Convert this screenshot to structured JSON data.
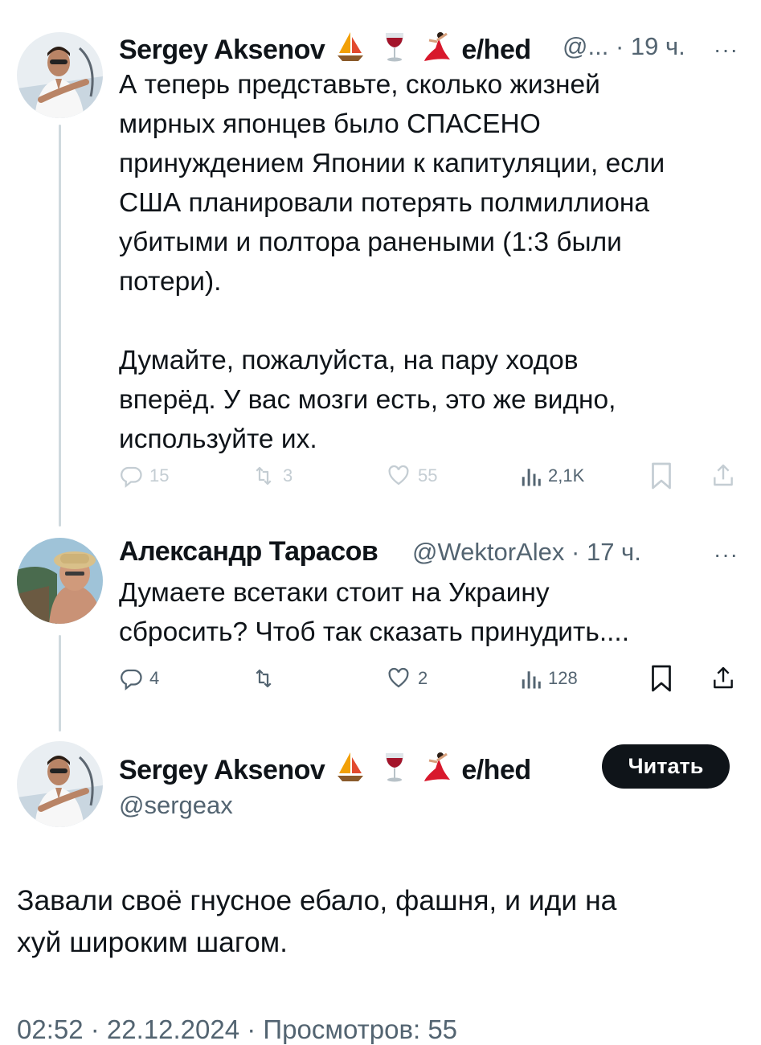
{
  "thread": [
    {
      "author": {
        "name": "Sergey Aksenov",
        "name_suffix": "e/hed",
        "handle": "@...",
        "time": "· 19 ч."
      },
      "text": "А теперь представьте, сколько жизней\nмирных японцев было СПАСЕНО\nпринуждением Японии к капитуляции, если\nСША планировали потерять полмиллиона\nубитыми и полтора ранеными (1:3 были\nпотери).\n\nДумайте, пожалуйста, на пару ходов\nвперёд. У вас мозги есть, это же видно,\nиспользуйте их.",
      "stats": {
        "replies": "15",
        "reposts": "3",
        "likes": "55",
        "views": "2,1K"
      }
    },
    {
      "author": {
        "name": "Александр Тарасов",
        "handle": "@WektorAlex",
        "time": "· 17 ч."
      },
      "text": "Думаете всетаки стоит на Украину\nсбросить? Чтоб так сказать принудить....",
      "stats": {
        "replies": "4",
        "reposts": "",
        "likes": "2",
        "views": "128"
      }
    }
  ],
  "main_post": {
    "author": {
      "name": "Sergey Aksenov",
      "name_suffix": "e/hed",
      "handle": "@sergeax"
    },
    "follow_label": "Читать",
    "text": "Завали своё гнусное ебало, фашня, и иди на\nхуй широким шагом.",
    "footer": "02:52 · 22.12.2024 · Просмотров: 55"
  },
  "more_label": "···",
  "colors": {
    "text": "#0f1419",
    "secondary": "#536471",
    "faded": "#c4cdd3",
    "line": "#cfd9de"
  },
  "icons": [
    "reply-icon",
    "repost-icon",
    "like-icon",
    "views-icon",
    "bookmark-icon",
    "share-icon",
    "sailboat-icon",
    "wine-glass-icon",
    "dancer-icon"
  ]
}
